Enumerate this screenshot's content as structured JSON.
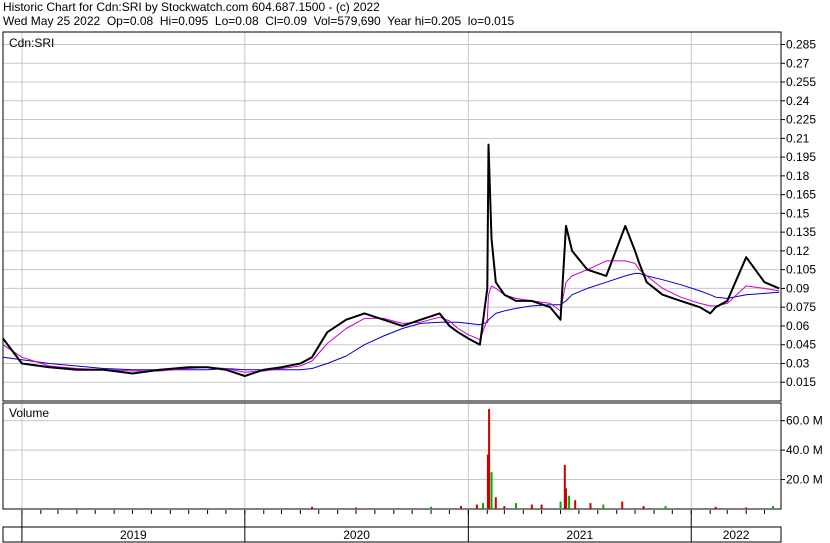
{
  "header": {
    "title": "Historic Chart for Cdn:SRI by Stockwatch.com 604.687.1500 - (c) 2022",
    "stats": "Wed May 25 2022  Op=0.08  Hi=0.095  Lo=0.08  Cl=0.09  Vol=579,690  Year hi=0.205  lo=0.015"
  },
  "price_panel": {
    "label": "Cdn:SRI"
  },
  "volume_panel": {
    "label": "Volume"
  },
  "colors": {
    "price": "#000000",
    "ma_short": "#cc00cc",
    "ma_long": "#0000cc",
    "vol_up": "#00aa00",
    "vol_down": "#cc0000",
    "grid": "#c8c8c8"
  },
  "chart_data": [
    {
      "type": "line",
      "ylim": [
        0.0,
        0.295
      ],
      "yticks": [
        "0.285",
        "0.27",
        "0.255",
        "0.24",
        "0.225",
        "0.21",
        "0.195",
        "0.18",
        "0.165",
        "0.15",
        "0.135",
        "0.12",
        "0.105",
        "0.09",
        "0.075",
        "0.06",
        "0.045",
        "0.03",
        "0.015"
      ],
      "x": [
        "2018-12-01",
        "2019-01-01",
        "2019-02-15",
        "2019-04-01",
        "2019-05-15",
        "2019-07-01",
        "2019-08-15",
        "2019-10-01",
        "2019-11-01",
        "2019-12-01",
        "2020-01-01",
        "2020-02-01",
        "2020-03-01",
        "2020-04-01",
        "2020-04-20",
        "2020-05-15",
        "2020-06-15",
        "2020-07-15",
        "2020-08-15",
        "2020-09-15",
        "2020-10-15",
        "2020-11-15",
        "2020-12-01",
        "2020-12-15",
        "2021-01-01",
        "2021-01-20",
        "2021-02-01",
        "2021-02-03",
        "2021-02-08",
        "2021-02-15",
        "2021-03-01",
        "2021-03-20",
        "2021-04-15",
        "2021-05-15",
        "2021-06-01",
        "2021-06-10",
        "2021-06-20",
        "2021-07-15",
        "2021-08-15",
        "2021-09-15",
        "2021-10-01",
        "2021-10-08",
        "2021-10-20",
        "2021-11-15",
        "2021-12-15",
        "2022-01-15",
        "2022-02-01",
        "2022-02-10",
        "2022-03-01",
        "2022-04-01",
        "2022-05-01",
        "2022-05-25"
      ],
      "series": [
        {
          "values": [
            0.05,
            0.03,
            0.027,
            0.025,
            0.025,
            0.022,
            0.025,
            0.027,
            0.027,
            0.025,
            0.02,
            0.025,
            0.027,
            0.03,
            0.035,
            0.055,
            0.065,
            0.07,
            0.065,
            0.06,
            0.065,
            0.07,
            0.06,
            0.055,
            0.05,
            0.045,
            0.09,
            0.205,
            0.13,
            0.095,
            0.085,
            0.08,
            0.08,
            0.075,
            0.065,
            0.14,
            0.12,
            0.105,
            0.1,
            0.14,
            0.12,
            0.11,
            0.095,
            0.085,
            0.08,
            0.075,
            0.07,
            0.075,
            0.08,
            0.115,
            0.095,
            0.09
          ]
        },
        {
          "values": [
            0.045,
            0.035,
            0.028,
            0.026,
            0.025,
            0.024,
            0.024,
            0.026,
            0.027,
            0.026,
            0.023,
            0.024,
            0.026,
            0.028,
            0.032,
            0.046,
            0.058,
            0.066,
            0.066,
            0.062,
            0.063,
            0.067,
            0.064,
            0.058,
            0.053,
            0.049,
            0.065,
            0.085,
            0.092,
            0.09,
            0.085,
            0.082,
            0.08,
            0.078,
            0.072,
            0.095,
            0.1,
            0.105,
            0.112,
            0.112,
            0.11,
            0.105,
            0.1,
            0.09,
            0.083,
            0.078,
            0.076,
            0.076,
            0.078,
            0.092,
            0.09,
            0.088
          ]
        },
        {
          "values": [
            0.035,
            0.033,
            0.03,
            0.028,
            0.026,
            0.025,
            0.025,
            0.025,
            0.025,
            0.026,
            0.025,
            0.025,
            0.025,
            0.025,
            0.026,
            0.03,
            0.036,
            0.045,
            0.052,
            0.058,
            0.062,
            0.063,
            0.063,
            0.063,
            0.062,
            0.061,
            0.063,
            0.065,
            0.067,
            0.07,
            0.072,
            0.074,
            0.076,
            0.077,
            0.077,
            0.08,
            0.085,
            0.09,
            0.095,
            0.1,
            0.102,
            0.102,
            0.1,
            0.097,
            0.093,
            0.088,
            0.085,
            0.083,
            0.082,
            0.085,
            0.086,
            0.087
          ]
        }
      ]
    },
    {
      "type": "bar",
      "ylim": [
        0,
        72
      ],
      "yticks": [
        "60.0 M",
        "40.0 M",
        "20.0 M"
      ],
      "x": [
        "2019-03-01",
        "2019-09-01",
        "2020-04-20",
        "2020-07-01",
        "2020-11-01",
        "2020-12-20",
        "2021-01-15",
        "2021-01-25",
        "2021-02-02",
        "2021-02-04",
        "2021-02-08",
        "2021-02-15",
        "2021-03-01",
        "2021-03-20",
        "2021-04-15",
        "2021-05-01",
        "2021-06-01",
        "2021-06-08",
        "2021-06-10",
        "2021-06-15",
        "2021-06-25",
        "2021-07-20",
        "2021-08-10",
        "2021-09-10",
        "2021-10-15",
        "2021-11-20",
        "2022-02-10",
        "2022-04-01",
        "2022-05-15"
      ],
      "values": [
        0.5,
        0.5,
        1.5,
        1.0,
        1.5,
        2.0,
        3.0,
        4.0,
        37.0,
        68.0,
        25.0,
        8.0,
        2.0,
        4.0,
        3.0,
        3.0,
        5.0,
        30.0,
        14.0,
        9.0,
        6.0,
        4.0,
        3.0,
        5.0,
        2.0,
        2.0,
        1.5,
        1.0,
        2.0
      ]
    }
  ],
  "x_axis": {
    "labels": [
      "2019",
      "2020",
      "2021",
      "2022"
    ]
  }
}
